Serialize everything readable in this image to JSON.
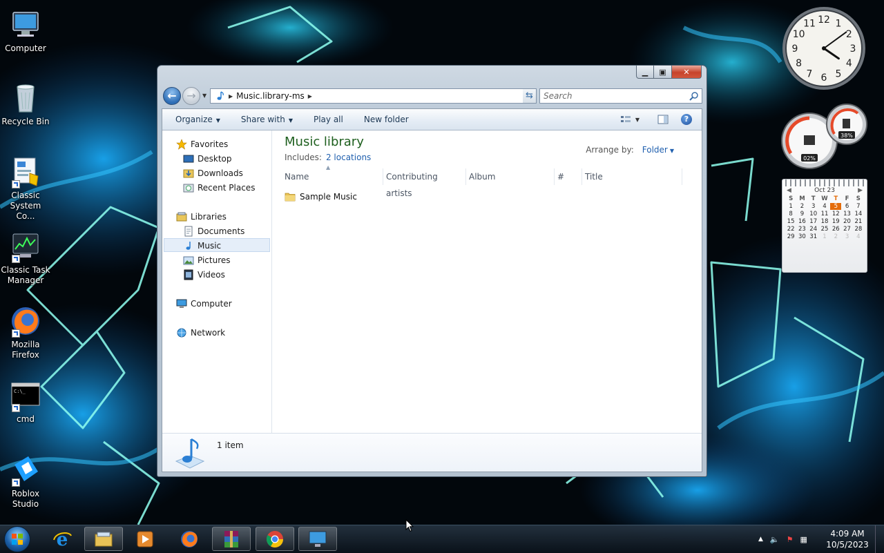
{
  "desktop": {
    "icons": [
      {
        "label": "Computer"
      },
      {
        "label": "Recycle Bin"
      },
      {
        "label": "Classic System Co..."
      },
      {
        "label": "Classic Task Manager"
      },
      {
        "label": "Mozilla Firefox"
      },
      {
        "label": "cmd"
      },
      {
        "label": "Roblox Studio"
      }
    ]
  },
  "gadgets": {
    "clock": {
      "numerals": [
        "12",
        "1",
        "2",
        "3",
        "4",
        "5",
        "6",
        "7",
        "8",
        "9",
        "10",
        "11"
      ],
      "hour": 4,
      "minute": 9
    },
    "meter": {
      "cpu": "02%",
      "memory": "38%"
    },
    "calendar": {
      "month": "Oct 23",
      "dow": [
        "S",
        "M",
        "T",
        "W",
        "T",
        "F",
        "S"
      ],
      "today": "5",
      "weeks": [
        [
          "1",
          "2",
          "3",
          "4",
          "5",
          "6",
          "7"
        ],
        [
          "8",
          "9",
          "10",
          "11",
          "12",
          "13",
          "14"
        ],
        [
          "15",
          "16",
          "17",
          "18",
          "19",
          "20",
          "21"
        ],
        [
          "22",
          "23",
          "24",
          "25",
          "26",
          "27",
          "28"
        ],
        [
          "29",
          "30",
          "31",
          "1",
          "2",
          "3",
          "4"
        ]
      ]
    }
  },
  "explorer": {
    "address": {
      "path": "Music.library-ms"
    },
    "search": {
      "placeholder": "Search"
    },
    "toolbar": {
      "organize": "Organize",
      "share_with": "Share with",
      "play_all": "Play all",
      "new_folder": "New folder"
    },
    "nav": {
      "favorites": "Favorites",
      "desktop": "Desktop",
      "downloads": "Downloads",
      "recent": "Recent Places",
      "libraries": "Libraries",
      "documents": "Documents",
      "music": "Music",
      "pictures": "Pictures",
      "videos": "Videos",
      "computer": "Computer",
      "network": "Network"
    },
    "library": {
      "title": "Music library",
      "includes_label": "Includes:",
      "includes_link": "2 locations",
      "arrange_label": "Arrange by:",
      "arrange_value": "Folder"
    },
    "columns": [
      "Name",
      "Contributing artists",
      "Album",
      "#",
      "Title"
    ],
    "items": [
      {
        "name": "Sample Music"
      }
    ],
    "details": {
      "count": "1 item"
    }
  },
  "taskbar": {
    "time": "4:09 AM",
    "date": "10/5/2023"
  },
  "colors": {
    "accent": "#1f5fae",
    "library_title": "#1e5f1e",
    "today": "#e46c0a"
  }
}
